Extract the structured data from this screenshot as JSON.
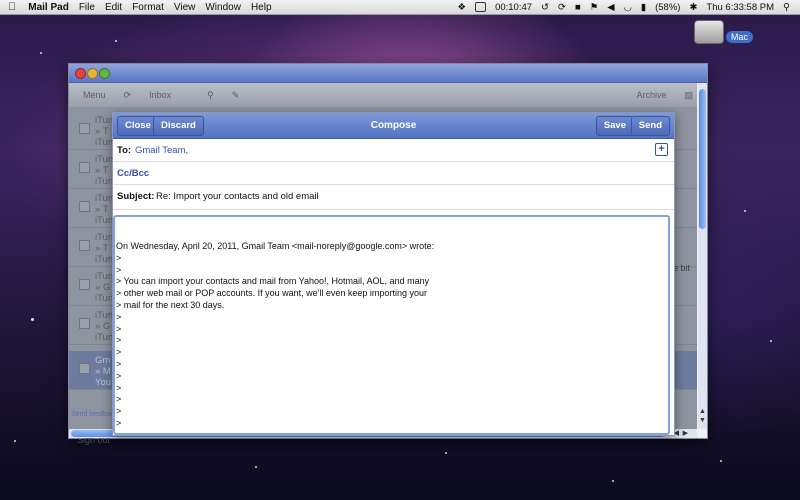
{
  "menubar": {
    "apple": "",
    "app_name": "Mail Pad",
    "menus": [
      "File",
      "Edit",
      "Format",
      "View",
      "Window",
      "Help"
    ],
    "timer": "00:10:47",
    "battery": "(58%)",
    "clock": "Thu 6:33:58 PM"
  },
  "desktop": {
    "drive_label": "Mac"
  },
  "inbox": {
    "toolbar": {
      "menu": "Menu",
      "inbox": "Inbox",
      "archive": "Archive"
    },
    "rows": [
      {
        "line1": "iTun",
        "line2": "» T",
        "line3": "iTun"
      },
      {
        "line1": "iTun",
        "line2": "» T",
        "line3": "iTun"
      },
      {
        "line1": "iTun",
        "line2": "» T",
        "line3": "iTun"
      },
      {
        "line1": "iTun",
        "line2": "» T",
        "line3": "iTun"
      },
      {
        "line1": "iTun",
        "line2": "» G",
        "line3": "iTun"
      },
      {
        "line1": "iTun",
        "line2": "» G",
        "line3": "iTun"
      },
      {
        "line1": "Gm",
        "line2": "» M",
        "line3": "You"
      }
    ],
    "footer_feedback": "Send feedbac",
    "footer_signout": "Sign out",
    "peek": "e bit"
  },
  "compose": {
    "close": "Close",
    "discard": "Discard",
    "title": "Compose",
    "save": "Save",
    "send": "Send",
    "to_label": "To:",
    "to_value": "Gmail Team,",
    "ccbcc": "Cc/Bcc",
    "subject_label": "Subject:",
    "subject_value": "Re: Import your contacts and old email",
    "body": "On Wednesday, April 20, 2011, Gmail Team <mail-noreply@google.com> wrote:\n>\n>\n> You can import your contacts and mail from Yahoo!, Hotmail, AOL, and many\n> other web mail or POP accounts. If you want, we'll even keep importing your\n> mail for the next 30 days.\n>\n>\n>\n>\n>\n>\n>\n>\n>\n>"
  }
}
